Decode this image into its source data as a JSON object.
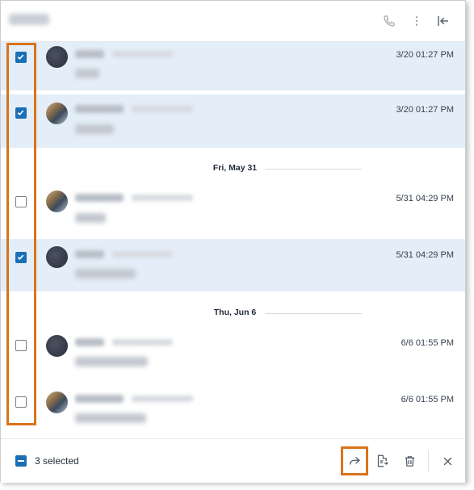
{
  "header": {
    "call_icon": "phone-icon",
    "more_icon": "more-vertical-icon",
    "collapse_icon": "collapse-left-icon"
  },
  "date_separators": [
    "Fri, May 31",
    "Thu, Jun 6"
  ],
  "messages": [
    {
      "time": "3/20 01:27 PM",
      "selected": true
    },
    {
      "time": "3/20 01:27 PM",
      "selected": true
    },
    {
      "time": "5/31 04:29 PM",
      "selected": false
    },
    {
      "time": "5/31 04:29 PM",
      "selected": true
    },
    {
      "time": "6/6 01:55 PM",
      "selected": false
    },
    {
      "time": "6/6 01:55 PM",
      "selected": false
    }
  ],
  "footer": {
    "selected_label": "3 selected",
    "forward_icon": "forward-icon",
    "export_icon": "export-icon",
    "delete_icon": "trash-icon",
    "close_icon": "close-icon"
  },
  "colors": {
    "accent": "#1a6fb5",
    "highlight": "#d9731a",
    "selected_row": "#e4eef8"
  }
}
